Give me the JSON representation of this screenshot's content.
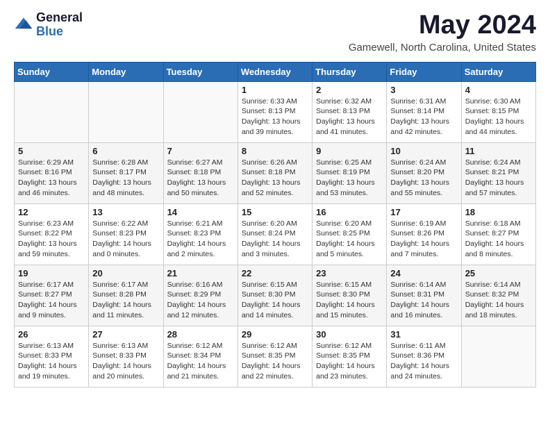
{
  "header": {
    "logo_general": "General",
    "logo_blue": "Blue",
    "month_title": "May 2024",
    "location": "Gamewell, North Carolina, United States"
  },
  "weekdays": [
    "Sunday",
    "Monday",
    "Tuesday",
    "Wednesday",
    "Thursday",
    "Friday",
    "Saturday"
  ],
  "weeks": [
    [
      {
        "day": "",
        "sunrise": "",
        "sunset": "",
        "daylight": ""
      },
      {
        "day": "",
        "sunrise": "",
        "sunset": "",
        "daylight": ""
      },
      {
        "day": "",
        "sunrise": "",
        "sunset": "",
        "daylight": ""
      },
      {
        "day": "1",
        "sunrise": "6:33 AM",
        "sunset": "8:13 PM",
        "daylight": "13 hours and 39 minutes."
      },
      {
        "day": "2",
        "sunrise": "6:32 AM",
        "sunset": "8:13 PM",
        "daylight": "13 hours and 41 minutes."
      },
      {
        "day": "3",
        "sunrise": "6:31 AM",
        "sunset": "8:14 PM",
        "daylight": "13 hours and 42 minutes."
      },
      {
        "day": "4",
        "sunrise": "6:30 AM",
        "sunset": "8:15 PM",
        "daylight": "13 hours and 44 minutes."
      }
    ],
    [
      {
        "day": "5",
        "sunrise": "6:29 AM",
        "sunset": "8:16 PM",
        "daylight": "13 hours and 46 minutes."
      },
      {
        "day": "6",
        "sunrise": "6:28 AM",
        "sunset": "8:17 PM",
        "daylight": "13 hours and 48 minutes."
      },
      {
        "day": "7",
        "sunrise": "6:27 AM",
        "sunset": "8:18 PM",
        "daylight": "13 hours and 50 minutes."
      },
      {
        "day": "8",
        "sunrise": "6:26 AM",
        "sunset": "8:18 PM",
        "daylight": "13 hours and 52 minutes."
      },
      {
        "day": "9",
        "sunrise": "6:25 AM",
        "sunset": "8:19 PM",
        "daylight": "13 hours and 53 minutes."
      },
      {
        "day": "10",
        "sunrise": "6:24 AM",
        "sunset": "8:20 PM",
        "daylight": "13 hours and 55 minutes."
      },
      {
        "day": "11",
        "sunrise": "6:24 AM",
        "sunset": "8:21 PM",
        "daylight": "13 hours and 57 minutes."
      }
    ],
    [
      {
        "day": "12",
        "sunrise": "6:23 AM",
        "sunset": "8:22 PM",
        "daylight": "13 hours and 59 minutes."
      },
      {
        "day": "13",
        "sunrise": "6:22 AM",
        "sunset": "8:23 PM",
        "daylight": "14 hours and 0 minutes."
      },
      {
        "day": "14",
        "sunrise": "6:21 AM",
        "sunset": "8:23 PM",
        "daylight": "14 hours and 2 minutes."
      },
      {
        "day": "15",
        "sunrise": "6:20 AM",
        "sunset": "8:24 PM",
        "daylight": "14 hours and 3 minutes."
      },
      {
        "day": "16",
        "sunrise": "6:20 AM",
        "sunset": "8:25 PM",
        "daylight": "14 hours and 5 minutes."
      },
      {
        "day": "17",
        "sunrise": "6:19 AM",
        "sunset": "8:26 PM",
        "daylight": "14 hours and 7 minutes."
      },
      {
        "day": "18",
        "sunrise": "6:18 AM",
        "sunset": "8:27 PM",
        "daylight": "14 hours and 8 minutes."
      }
    ],
    [
      {
        "day": "19",
        "sunrise": "6:17 AM",
        "sunset": "8:27 PM",
        "daylight": "14 hours and 9 minutes."
      },
      {
        "day": "20",
        "sunrise": "6:17 AM",
        "sunset": "8:28 PM",
        "daylight": "14 hours and 11 minutes."
      },
      {
        "day": "21",
        "sunrise": "6:16 AM",
        "sunset": "8:29 PM",
        "daylight": "14 hours and 12 minutes."
      },
      {
        "day": "22",
        "sunrise": "6:15 AM",
        "sunset": "8:30 PM",
        "daylight": "14 hours and 14 minutes."
      },
      {
        "day": "23",
        "sunrise": "6:15 AM",
        "sunset": "8:30 PM",
        "daylight": "14 hours and 15 minutes."
      },
      {
        "day": "24",
        "sunrise": "6:14 AM",
        "sunset": "8:31 PM",
        "daylight": "14 hours and 16 minutes."
      },
      {
        "day": "25",
        "sunrise": "6:14 AM",
        "sunset": "8:32 PM",
        "daylight": "14 hours and 18 minutes."
      }
    ],
    [
      {
        "day": "26",
        "sunrise": "6:13 AM",
        "sunset": "8:33 PM",
        "daylight": "14 hours and 19 minutes."
      },
      {
        "day": "27",
        "sunrise": "6:13 AM",
        "sunset": "8:33 PM",
        "daylight": "14 hours and 20 minutes."
      },
      {
        "day": "28",
        "sunrise": "6:12 AM",
        "sunset": "8:34 PM",
        "daylight": "14 hours and 21 minutes."
      },
      {
        "day": "29",
        "sunrise": "6:12 AM",
        "sunset": "8:35 PM",
        "daylight": "14 hours and 22 minutes."
      },
      {
        "day": "30",
        "sunrise": "6:12 AM",
        "sunset": "8:35 PM",
        "daylight": "14 hours and 23 minutes."
      },
      {
        "day": "31",
        "sunrise": "6:11 AM",
        "sunset": "8:36 PM",
        "daylight": "14 hours and 24 minutes."
      },
      {
        "day": "",
        "sunrise": "",
        "sunset": "",
        "daylight": ""
      }
    ]
  ],
  "labels": {
    "sunrise": "Sunrise:",
    "sunset": "Sunset:",
    "daylight": "Daylight:"
  }
}
